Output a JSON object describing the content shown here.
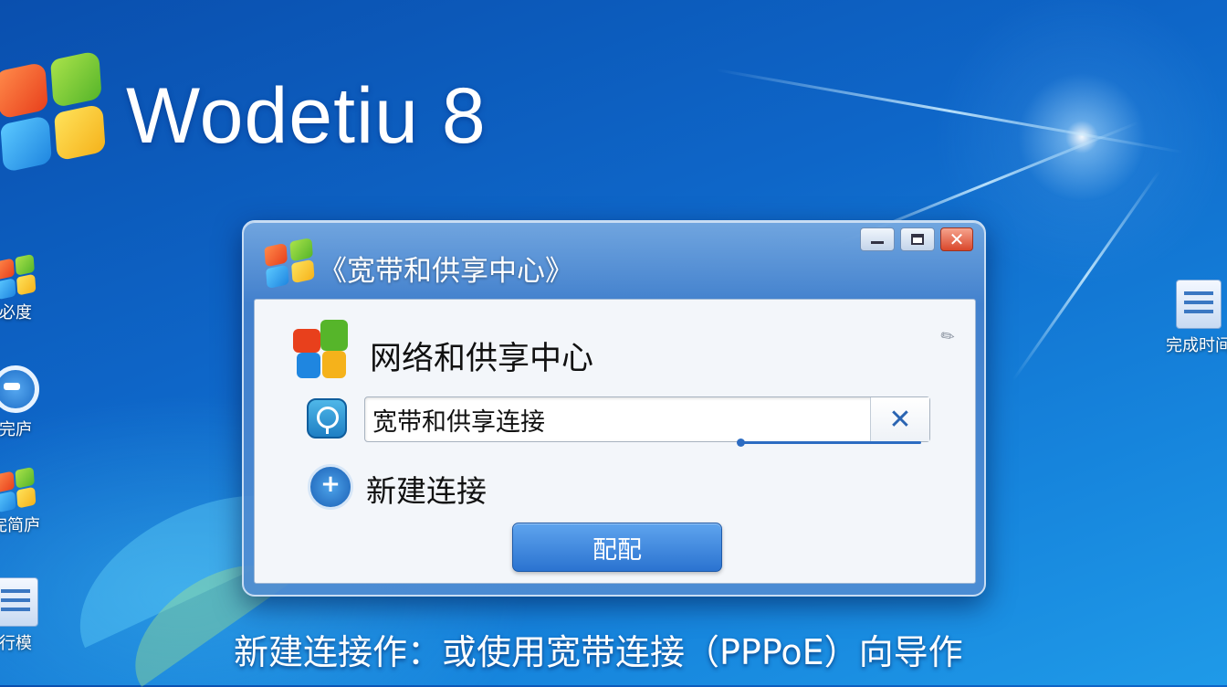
{
  "desktop": {
    "brand_text": "Wodetiu 8",
    "left_icons": [
      {
        "label": "必度",
        "icon": "windows-logo-icon"
      },
      {
        "label": "完庐",
        "icon": "refresh-icon"
      },
      {
        "label": "完简庐",
        "icon": "windows-logo-icon"
      },
      {
        "label": "行模",
        "icon": "control-panel-icon"
      }
    ],
    "right_icons": [
      {
        "label": "完成时间",
        "icon": "document-icon"
      }
    ],
    "caption": "新建连接作：或使用宽带连接（PPPoE）向导作"
  },
  "window": {
    "title": "《宽带和供享中心》",
    "controls": {
      "minimize": "minimize-icon",
      "maximize": "maximize-icon",
      "close": "close-icon"
    },
    "header": "网络和供享中心",
    "search": {
      "value": "宽带和供享连接",
      "clear_glyph": "✕"
    },
    "new_connection_label": "新建连接",
    "ok_button": "配配"
  },
  "colors": {
    "desktop": "#0e66c8",
    "accent": "#2b73d0",
    "close": "#d9472b"
  }
}
